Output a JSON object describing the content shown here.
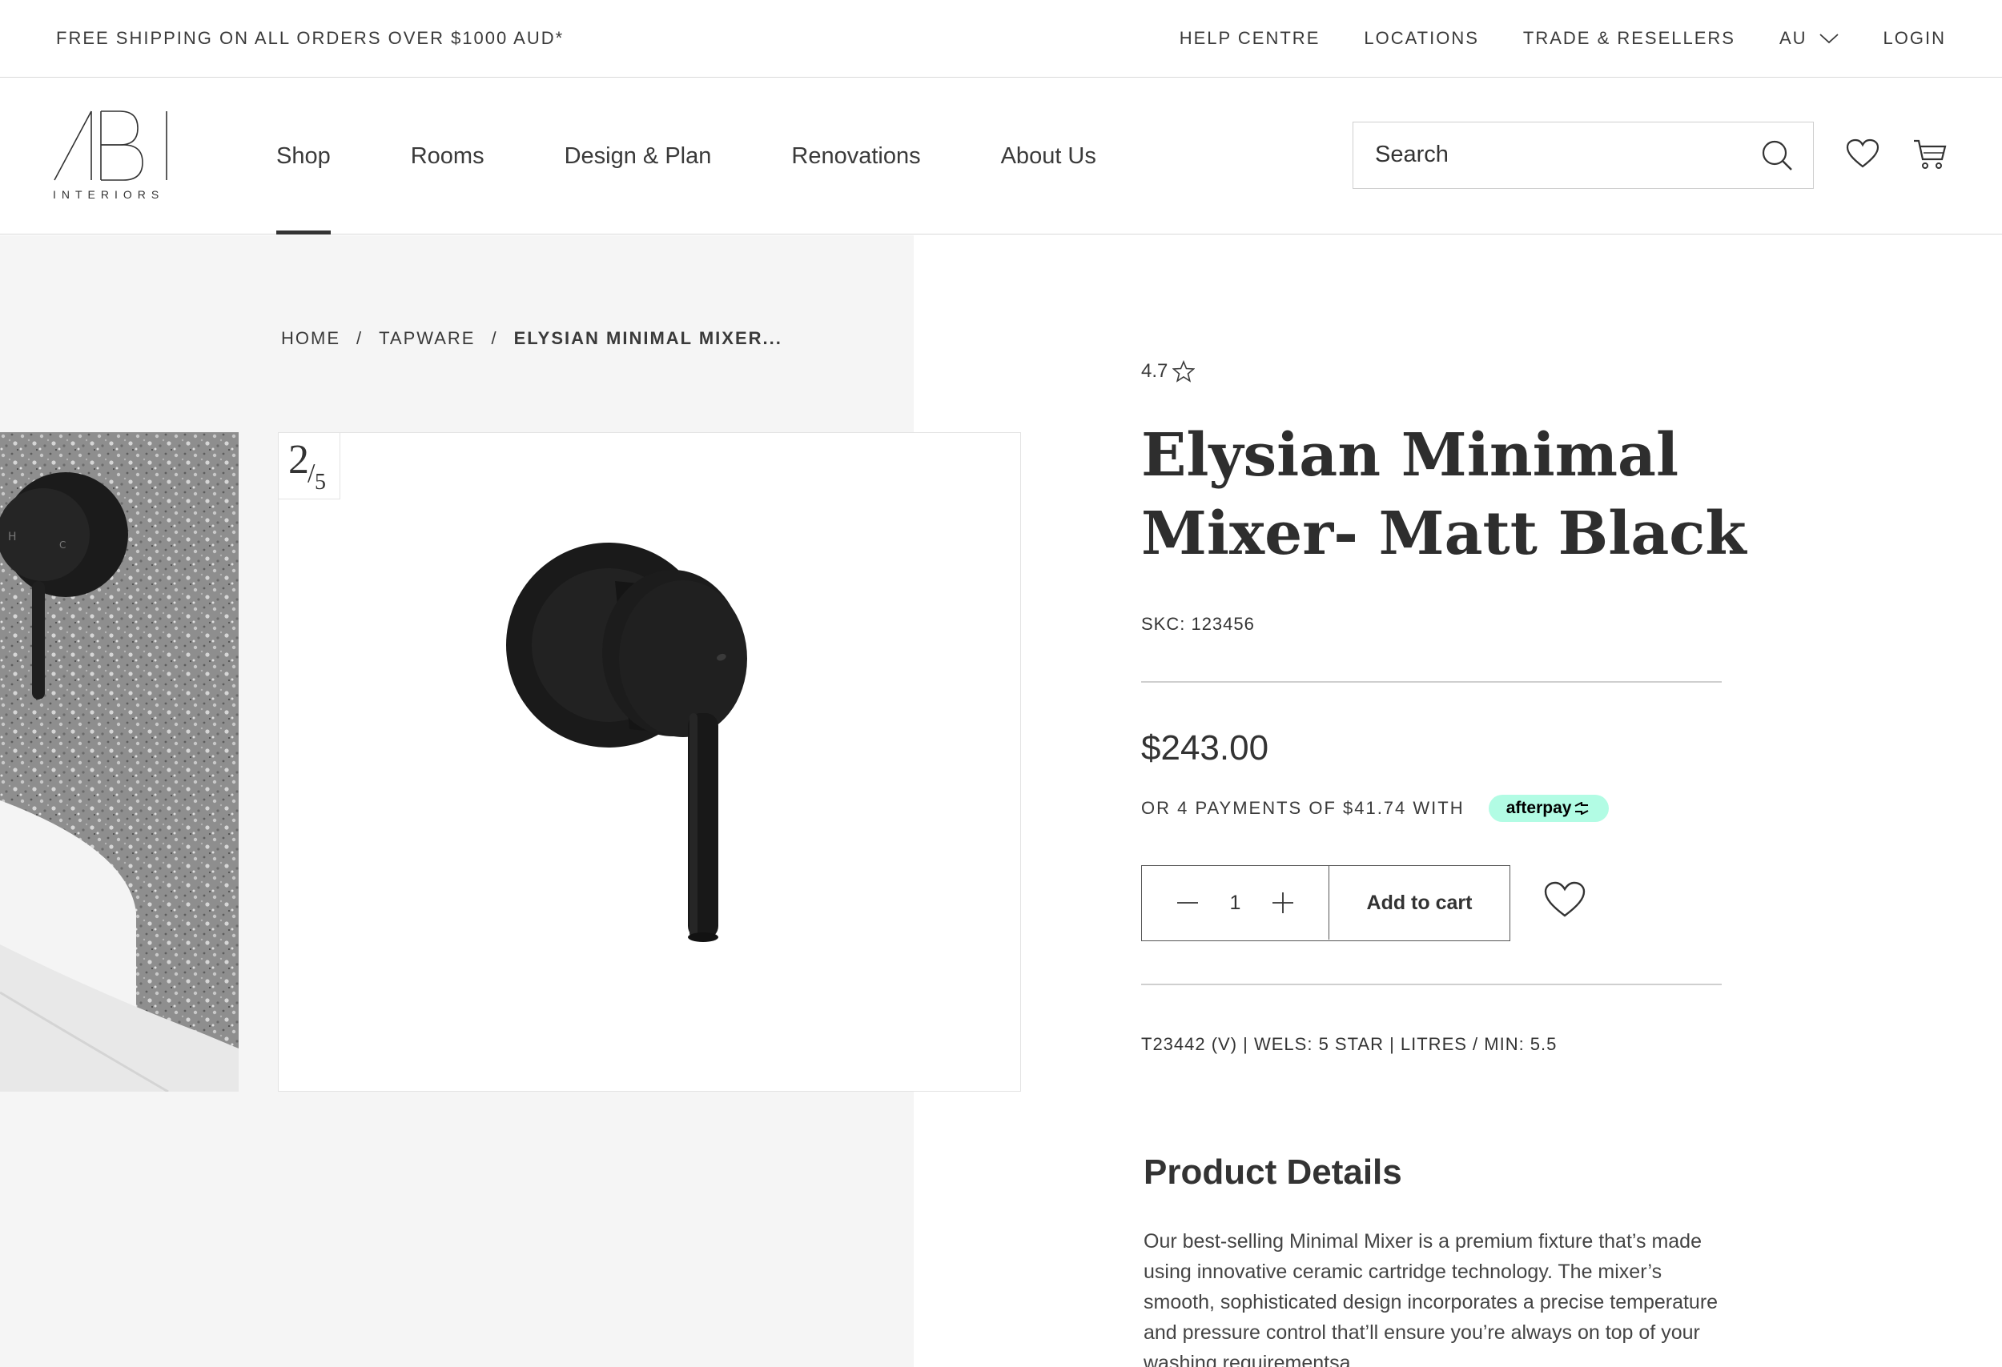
{
  "topbar": {
    "promo": "FREE SHIPPING ON ALL ORDERS OVER $1000 AUD*",
    "links": [
      "HELP CENTRE",
      "LOCATIONS",
      "TRADE & RESELLERS"
    ],
    "locale": "AU",
    "login": "LOGIN"
  },
  "header": {
    "logo_mark": "ABI",
    "logo_text": "INTERIORS",
    "nav": [
      "Shop",
      "Rooms",
      "Design & Plan",
      "Renovations",
      "About Us"
    ],
    "active_nav": "Shop",
    "search_placeholder": "Search",
    "icons": [
      "search-icon",
      "heart-icon",
      "cart-icon"
    ]
  },
  "breadcrumb": {
    "items": [
      "HOME",
      "TAPWARE"
    ],
    "current": "ELYSIAN MINIMAL MIXER...",
    "separator": "/"
  },
  "gallery": {
    "current": "2",
    "total": "5"
  },
  "product": {
    "rating": "4.7",
    "title_line1": "Elysian Minimal",
    "title_line2": "Mixer- Matt Black",
    "sku": "SKC: 123456",
    "price": "$243.00",
    "installments": "OR 4 PAYMENTS OF $41.74 WITH",
    "afterpay": "afterpay",
    "quantity": "1",
    "add_to_cart": "Add to cart",
    "specs": "T23442 (V) | WELS: 5 STAR | LITRES / MIN: 5.5",
    "details_heading": "Product Details",
    "details_body": "Our best-selling Minimal Mixer is a premium fixture that’s made using innovative ceramic cartridge technology. The mixer’s smooth, sophisticated design incorporates a precise temperature and pressure control that’ll ensure you’re always on top of your washing requirementsa."
  },
  "colors": {
    "text": "#333333",
    "gallery_bg": "#f5f5f5",
    "afterpay_mint": "#b2fce4",
    "rule": "#cfcfcf"
  }
}
